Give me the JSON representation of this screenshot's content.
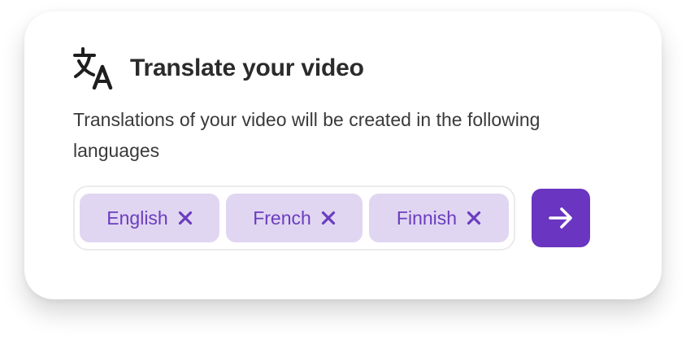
{
  "card": {
    "title": "Translate your video",
    "icon": "translate-icon",
    "description": "Translations of your video will be created in the following languages"
  },
  "languages": {
    "tags": [
      {
        "label": "English",
        "remove_icon": "close-icon"
      },
      {
        "label": "French",
        "remove_icon": "close-icon"
      },
      {
        "label": "Finnish",
        "remove_icon": "close-icon"
      }
    ]
  },
  "next_button": {
    "icon": "arrow-right-icon",
    "color": "#6a35c0"
  },
  "colors": {
    "tag_background": "#e1d6f1",
    "tag_text": "#6a3dbf",
    "title_text": "#2b2b2b"
  }
}
